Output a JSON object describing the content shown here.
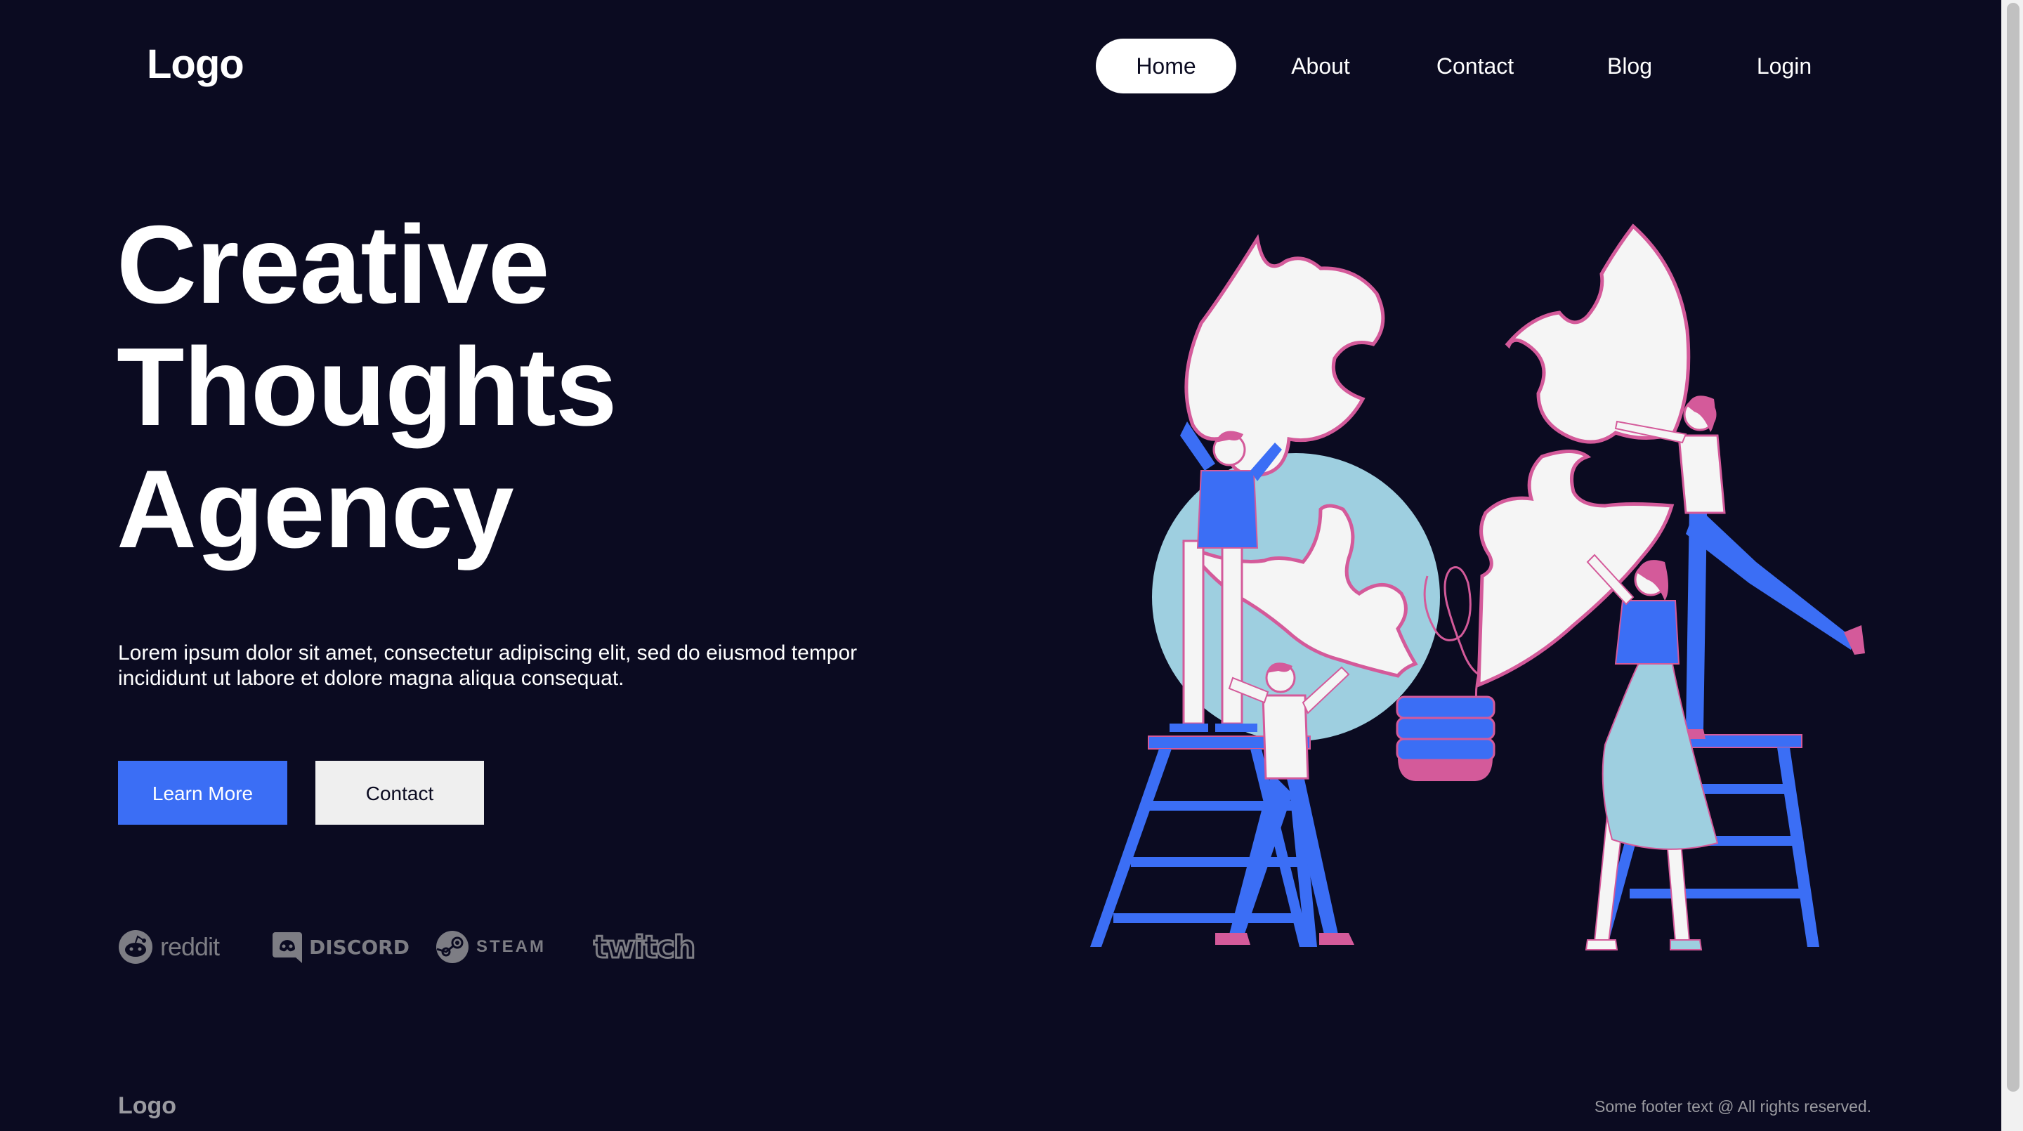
{
  "header": {
    "logo": "Logo",
    "nav": [
      {
        "label": "Home",
        "active": true
      },
      {
        "label": "About",
        "active": false
      },
      {
        "label": "Contact",
        "active": false
      },
      {
        "label": "Blog",
        "active": false
      },
      {
        "label": "Login",
        "active": false
      }
    ]
  },
  "hero": {
    "title_lines": [
      "Creative",
      "Thoughts",
      "Agency"
    ],
    "description": "Lorem ipsum dolor sit amet, consectetur adipiscing elit, sed do eiusmod tempor incididunt ut labore et dolore magna aliqua consequat.",
    "primary_button": "Learn More",
    "secondary_button": "Contact"
  },
  "partners": [
    {
      "name": "reddit",
      "icon": "reddit-icon"
    },
    {
      "name": "DISCORD",
      "icon": "discord-icon"
    },
    {
      "name": "STEAM",
      "icon": "steam-icon"
    },
    {
      "name": "twitch",
      "icon": "twitch-icon"
    }
  ],
  "illustration": {
    "icon": "team-assembling-puzzle-illustration",
    "colors": {
      "blue": "#3b6ef5",
      "pink": "#d45a9a",
      "light_blue": "#9ecfe0",
      "white": "#f5f5f5"
    }
  },
  "footer": {
    "logo": "Logo",
    "text": "Some footer text @ All rights reserved."
  },
  "theme": {
    "background": "#0b0b21",
    "accent": "#3b6ef5"
  }
}
